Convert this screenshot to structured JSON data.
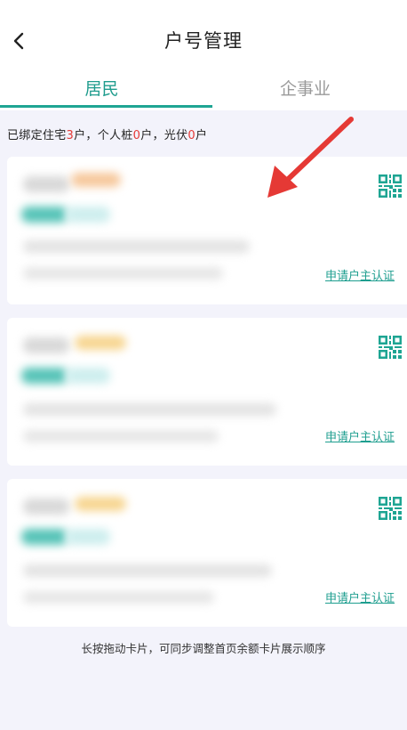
{
  "header": {
    "title": "户号管理",
    "back_icon": "chevron-left-icon"
  },
  "tabs": [
    {
      "label": "居民",
      "active": true
    },
    {
      "label": "企事业",
      "active": false
    }
  ],
  "summary": {
    "p1": "已绑定住宅",
    "v1": "3",
    "p2": "户，个人桩",
    "v2": "0",
    "p3": "户，光伏",
    "v3": "0",
    "p4": "户"
  },
  "cards": [
    {
      "link": "申请户主认证",
      "icon": "qr-code-icon"
    },
    {
      "link": "申请户主认证",
      "icon": "qr-code-icon"
    },
    {
      "link": "申请户主认证",
      "icon": "qr-code-icon"
    }
  ],
  "hint": "长按拖动卡片，可同步调整首页余额卡片展示顺序",
  "colors": {
    "accent": "#1ea593",
    "highlight": "#e53935",
    "background": "#f3f3fb",
    "arrow": "#e53935"
  }
}
